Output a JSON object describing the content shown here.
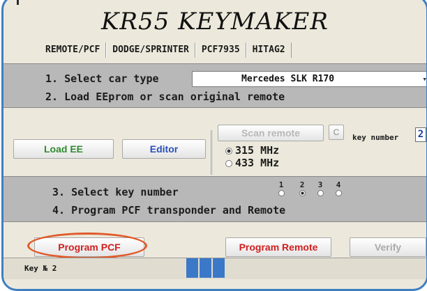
{
  "app": {
    "title": "KR55 KEYMAKER"
  },
  "tabs": [
    "REMOTE/PCF",
    "DODGE/SPRINTER",
    "PCF7935",
    "HITAG2"
  ],
  "steps": {
    "s1": "1. Select car type",
    "s2": "2. Load EEprom or scan original remote",
    "s3": "3. Select key number",
    "s4": "4. Program PCF transponder and Remote"
  },
  "car_select": {
    "value": "Mercedes  SLK R170",
    "arrow": "▾"
  },
  "buttons": {
    "load_ee": "Load EE",
    "editor": "Editor",
    "scan_remote": "Scan remote",
    "program_pcf": "Program PCF",
    "program_remote": "Program Remote",
    "verify": "Verify"
  },
  "small_checkbox": "C",
  "key_number_label": "key number",
  "key_number_value": "2",
  "frequencies": [
    {
      "label": "315 MHz",
      "selected": true
    },
    {
      "label": "433 MHz",
      "selected": false
    }
  ],
  "key_numbers": [
    {
      "label": "1",
      "selected": false
    },
    {
      "label": "2",
      "selected": true
    },
    {
      "label": "3",
      "selected": false
    },
    {
      "label": "4",
      "selected": false
    }
  ],
  "status": {
    "text": "Key № 2"
  },
  "colors": {
    "frame": "#3f7fc1",
    "green_label": "#2e8b2e",
    "blue_label": "#2a4fb8",
    "red_label": "#d02020",
    "highlight_ellipse": "#e05a2a",
    "status_block": "#3b78c8"
  }
}
